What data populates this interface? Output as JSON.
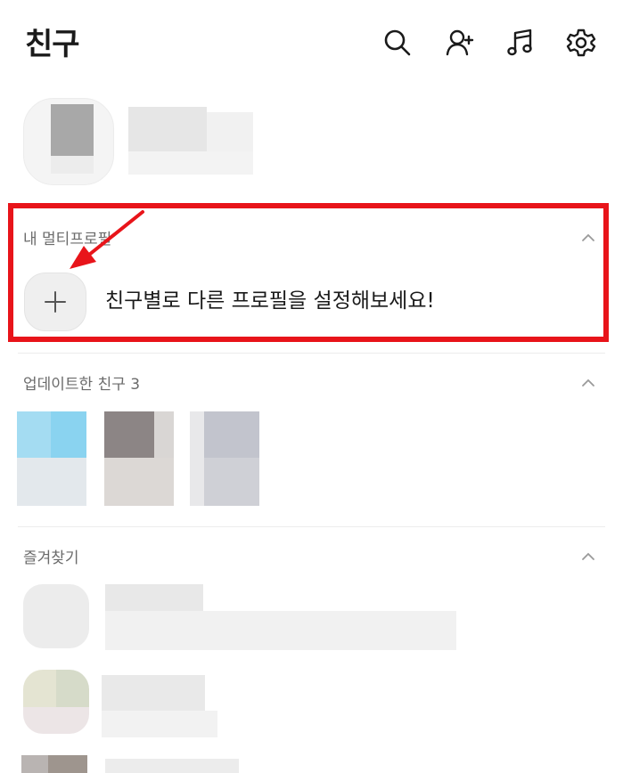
{
  "header": {
    "title": "친구",
    "icons": [
      "search-icon",
      "add-friend-icon",
      "music-icon",
      "settings-icon"
    ]
  },
  "multi_profile": {
    "title": "내 멀티프로필",
    "description": "친구별로 다른 프로필을 설정해보세요!",
    "add_icon": "plus-icon"
  },
  "updated_friends": {
    "title": "업데이트한 친구 3"
  },
  "favorites": {
    "title": "즐겨찾기"
  },
  "colors": {
    "highlight": "#e8141a",
    "section_text": "#6b6b6b"
  }
}
